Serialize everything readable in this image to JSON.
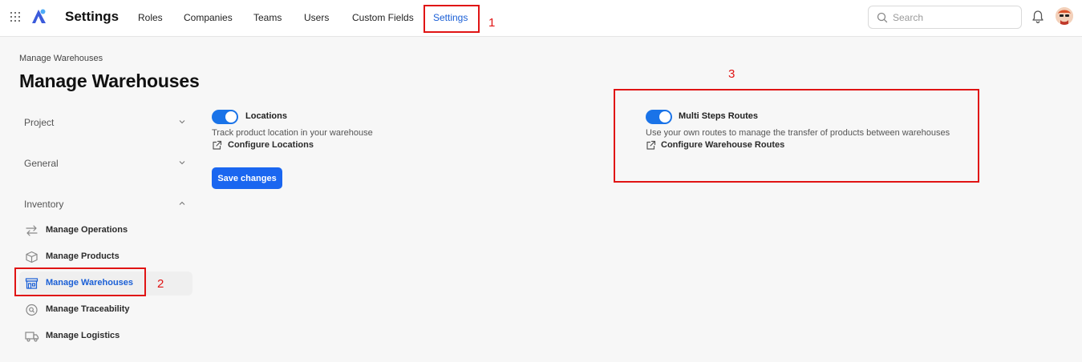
{
  "header": {
    "app_title": "Settings",
    "nav": [
      {
        "label": "Roles"
      },
      {
        "label": "Companies"
      },
      {
        "label": "Teams"
      },
      {
        "label": "Users"
      },
      {
        "label": "Custom Fields"
      },
      {
        "label": "Settings",
        "active": true
      }
    ],
    "search_placeholder": "Search"
  },
  "page": {
    "breadcrumb": "Manage Warehouses",
    "title": "Manage Warehouses"
  },
  "sidebar": {
    "sections": [
      {
        "label": "Project",
        "expanded": false
      },
      {
        "label": "General",
        "expanded": false
      },
      {
        "label": "Inventory",
        "expanded": true
      }
    ],
    "items": [
      {
        "label": "Manage Operations",
        "icon": "arrows-exchange-icon"
      },
      {
        "label": "Manage Products",
        "icon": "box-icon"
      },
      {
        "label": "Manage Warehouses",
        "icon": "warehouse-icon",
        "active": true
      },
      {
        "label": "Manage Traceability",
        "icon": "search-circle-icon"
      },
      {
        "label": "Manage Logistics",
        "icon": "truck-icon"
      }
    ]
  },
  "settings": {
    "locations": {
      "title": "Locations",
      "description": "Track product location in your warehouse",
      "link": "Configure Locations",
      "enabled": true
    },
    "multi_steps": {
      "title": "Multi Steps Routes",
      "description": "Use your own routes to manage the transfer of products between warehouses",
      "link": "Configure Warehouse Routes",
      "enabled": true
    },
    "save_label": "Save changes"
  },
  "annotations": [
    "1",
    "2",
    "3"
  ],
  "colors": {
    "accent": "#1a66f0",
    "annotation": "#e01414",
    "background": "#f7f7f7"
  }
}
